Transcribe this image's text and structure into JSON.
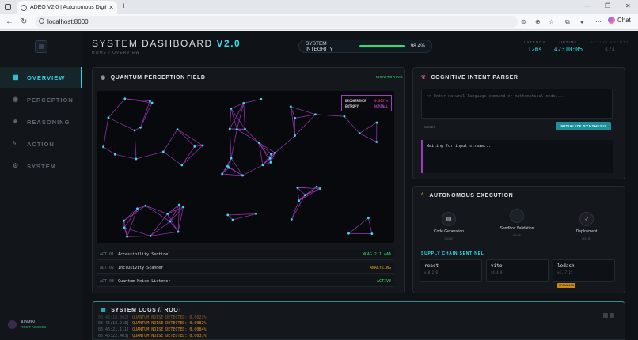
{
  "browser": {
    "tab_title": "ADEG V2.0 | Autonomous Digital",
    "url": "localhost:8000",
    "chat_label": "Chat"
  },
  "sidebar": {
    "items": [
      {
        "label": "OVERVIEW",
        "icon": "grid-icon",
        "active": true
      },
      {
        "label": "PERCEPTION",
        "icon": "eye-icon",
        "active": false
      },
      {
        "label": "REASONING",
        "icon": "brain-icon",
        "active": false
      },
      {
        "label": "ACTION",
        "icon": "bolt-icon",
        "active": false
      },
      {
        "label": "SYSTEM",
        "icon": "gear-icon",
        "active": false
      }
    ],
    "user": {
      "name": "ADMIN",
      "status": "ROOT ACCESS"
    }
  },
  "header": {
    "title": "SYSTEM DASHBOARD",
    "version": "V2.0",
    "breadcrumb": "HOME / OVERVIEW",
    "integrity_label": "SYSTEM INTEGRITY",
    "integrity_value": "98.4%",
    "integrity_fraction": 0.984,
    "stats": [
      {
        "label": "LATENCY",
        "value": "12ms"
      },
      {
        "label": "UPTIME",
        "value": "42:10:05"
      },
      {
        "label": "ACTIVE AGENTS",
        "value": "424"
      }
    ]
  },
  "perception": {
    "title": "QUANTUM PERCEPTION FIELD",
    "status": "MONITORING",
    "legend": {
      "coherence_label": "DECOHERENCE",
      "coherence_value": "0.0037%",
      "entropy_label": "ENTROPY",
      "entropy_value": "NOMINAL"
    },
    "agents": [
      {
        "id": "AGT-01",
        "name": "Accessibility Sentinel",
        "status": "WCAG 2.1 AAA",
        "color": "#2ee06b"
      },
      {
        "id": "AGT-02",
        "name": "Inclusivity Scanner",
        "status": "ANALYZING",
        "color": "#e0a21e"
      },
      {
        "id": "AGT-03",
        "name": "Quantum Noise Listener",
        "status": "ACTIVE",
        "color": "#2ee06b"
      }
    ]
  },
  "intent": {
    "title": "COGNITIVE INTENT PARSER",
    "placeholder": ">> Enter natural language command or mathematical model...",
    "count": "0/1024",
    "button": "INITIALIZE SYNTHESIS",
    "stream": "Waiting for input stream..."
  },
  "execution": {
    "title": "AUTONOMOUS EXECUTION",
    "steps": [
      {
        "name": "Code Generation",
        "status": "IDLE"
      },
      {
        "name": "Sandbox Validation",
        "status": "IDLE"
      },
      {
        "name": "Deployment",
        "status": "IDLE"
      }
    ],
    "supply_title": "SUPPLY CHAIN SENTINEL",
    "packages": [
      {
        "name": "react",
        "version": "v18.2.0",
        "badge": ""
      },
      {
        "name": "vite",
        "version": "v4.4.9",
        "badge": ""
      },
      {
        "name": "lodash",
        "version": "v4.17.15",
        "badge": "UPGRADING"
      }
    ]
  },
  "logs": {
    "title": "SYSTEM LOGS // ROOT",
    "lines": [
      {
        "time": "[06:46:18.802]",
        "text": "QUANTUM NOISE DETECTED: 0.0023%"
      },
      {
        "time": "[06:46:18.918]",
        "text": "QUANTUM NOISE DETECTED: 0.0082%"
      },
      {
        "time": "[06:46:21.111]",
        "text": "QUANTUM NOISE DETECTED: 0.0084%"
      },
      {
        "time": "[06:46:22.403]",
        "text": "QUANTUM NOISE DETECTED: 0.0031%"
      }
    ]
  },
  "colors": {
    "accent": "#34e0ef",
    "magenta": "#a13bbd",
    "ok": "#2ee06b",
    "warn": "#e0a21e"
  }
}
